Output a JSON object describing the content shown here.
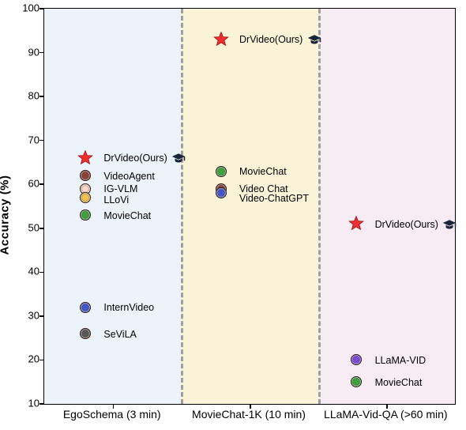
{
  "chart_data": {
    "type": "scatter",
    "ylabel": "Accuracy (%)",
    "ylim": [
      10,
      100
    ],
    "yticks": [
      10,
      20,
      30,
      40,
      50,
      60,
      70,
      80,
      90,
      100
    ],
    "categories": [
      "EgoSchema (3 min)",
      "MovieChat-1K (10 min)",
      "LLaMA-Vid-QA (>60 min)"
    ],
    "series": [
      {
        "group": 0,
        "name": "DrVideo(Ours)",
        "y": 66,
        "marker": "star",
        "color": "#ec2f2f",
        "grad": true
      },
      {
        "group": 0,
        "name": "VideoAgent",
        "y": 62,
        "marker": "circle",
        "color": "#8a413a"
      },
      {
        "group": 0,
        "name": "IG-VLM",
        "y": 59,
        "marker": "circle",
        "color": "#fbd8c9"
      },
      {
        "group": 0,
        "name": "LLoVi",
        "y": 57,
        "marker": "circle",
        "color": "#f2c34f"
      },
      {
        "group": 0,
        "name": "MovieChat",
        "y": 53,
        "marker": "circle",
        "color": "#3fa13d"
      },
      {
        "group": 0,
        "name": "InternVideo",
        "y": 32,
        "marker": "circle",
        "color": "#4656c7"
      },
      {
        "group": 0,
        "name": "SeViLA",
        "y": 26,
        "marker": "circle",
        "color": "#575757"
      },
      {
        "group": 1,
        "name": "DrVideo(Ours)",
        "y": 93,
        "marker": "star",
        "color": "#ec2f2f",
        "grad": true
      },
      {
        "group": 1,
        "name": "MovieChat",
        "y": 63,
        "marker": "circle",
        "color": "#3fa13d"
      },
      {
        "group": 1,
        "name": "Video Chat",
        "y": 59,
        "marker": "circle",
        "color": "#8a413a"
      },
      {
        "group": 1,
        "name": "Video-ChatGPT",
        "y": 58,
        "marker": "circle",
        "color": "#4656c7"
      },
      {
        "group": 2,
        "name": "DrVideo(Ours)",
        "y": 51,
        "marker": "star",
        "color": "#ec2f2f",
        "grad": true
      },
      {
        "group": 2,
        "name": "LLaMA-VID",
        "y": 20,
        "marker": "circle",
        "color": "#7c4bd9"
      },
      {
        "group": 2,
        "name": "MovieChat",
        "y": 15,
        "marker": "circle",
        "color": "#3fa13d"
      }
    ]
  }
}
